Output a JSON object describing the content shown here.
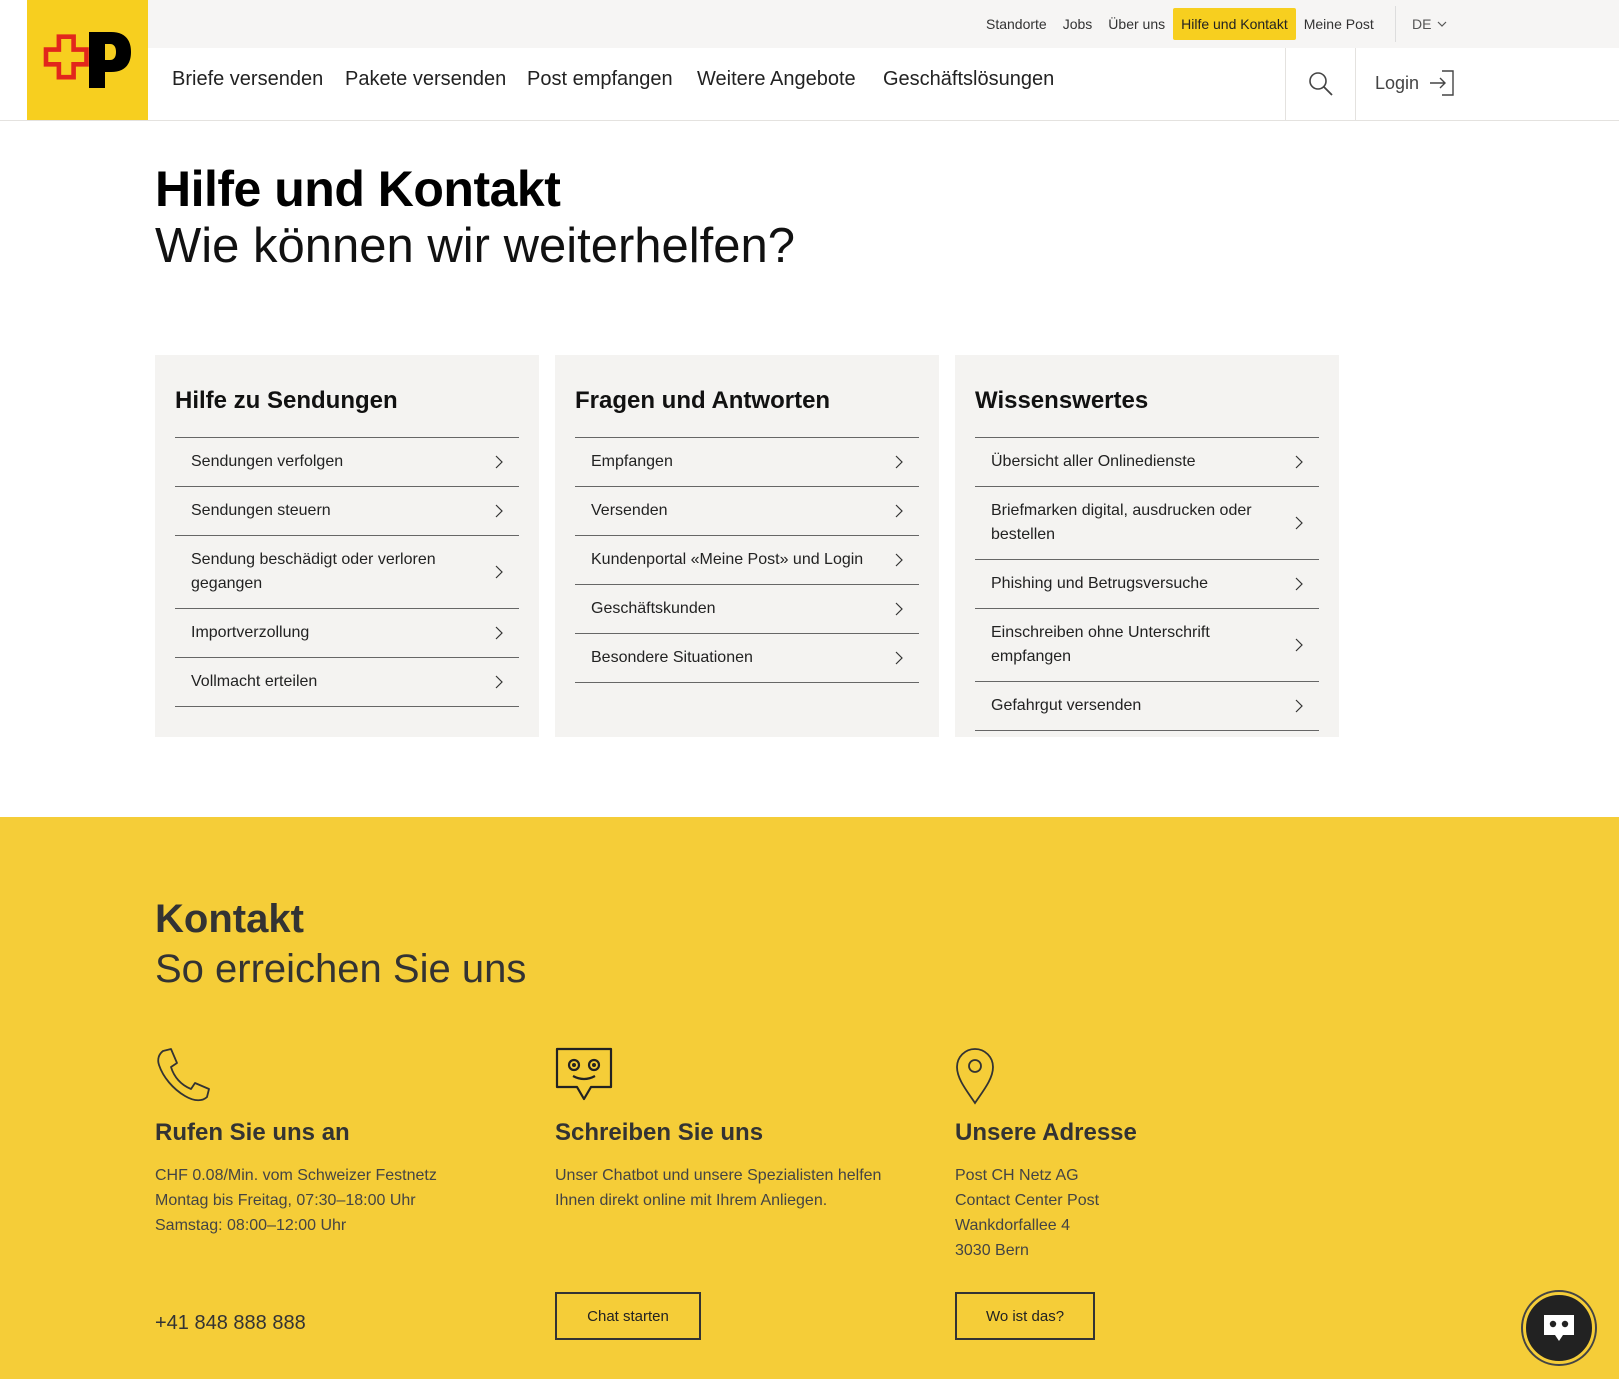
{
  "header": {
    "logo_alt": "Die Post",
    "top_links": [
      {
        "label": "Standorte"
      },
      {
        "label": "Jobs"
      },
      {
        "label": "Über uns"
      },
      {
        "label": "Hilfe und Kontakt",
        "active": true
      },
      {
        "label": "Meine Post"
      }
    ],
    "language": "DE",
    "main_nav": [
      {
        "label": "Briefe versenden"
      },
      {
        "label": "Pakete versenden"
      },
      {
        "label": "Post empfangen"
      },
      {
        "label": "Weitere Angebote"
      },
      {
        "label": "Geschäftslösungen"
      }
    ],
    "search_icon": "search-icon",
    "login_label": "Login"
  },
  "hero": {
    "title": "Hilfe und Kontakt",
    "subtitle": "Wie können wir weiterhelfen?"
  },
  "cards": [
    {
      "title": "Hilfe zu Sendungen",
      "items": [
        "Sendungen verfolgen",
        "Sendungen steuern",
        "Sendung beschädigt oder verloren gegangen",
        "Importverzollung",
        "Vollmacht erteilen"
      ]
    },
    {
      "title": "Fragen und Antworten",
      "items": [
        "Empfangen",
        "Versenden",
        "Kundenportal «Meine Post» und Login",
        "Geschäftskunden",
        "Besondere Situationen"
      ]
    },
    {
      "title": "Wissenswertes",
      "items": [
        "Übersicht aller Onlinedienste",
        "Briefmarken digital, ausdrucken oder bestellen",
        "Phishing und Betrugsversuche",
        "Einschreiben ohne Unterschrift empfangen",
        "Gefahrgut versenden"
      ]
    }
  ],
  "contact": {
    "title": "Kontakt",
    "subtitle": "So erreichen Sie uns",
    "phone": {
      "heading": "Rufen Sie uns an",
      "lines": [
        "CHF 0.08/Min. vom Schweizer Festnetz",
        "Montag bis Freitag, 07:30–18:00 Uhr",
        "Samstag: 08:00–12:00 Uhr"
      ],
      "number": "+41 848 888 888"
    },
    "chat": {
      "heading": "Schreiben Sie uns",
      "lines": [
        "Unser Chatbot und unsere Spezialisten helfen",
        "Ihnen direkt online mit Ihrem Anliegen."
      ],
      "button": "Chat starten"
    },
    "address": {
      "heading": "Unsere Adresse",
      "lines": [
        "Post CH Netz AG",
        "Contact Center Post",
        "Wankdorfallee 4",
        "3030 Bern"
      ],
      "button": "Wo ist das?"
    }
  },
  "colors": {
    "brand_yellow": "#f7cf1f",
    "contact_bg": "#f5cd38",
    "card_bg": "#f4f3f1",
    "logo_red": "#e2261c"
  }
}
